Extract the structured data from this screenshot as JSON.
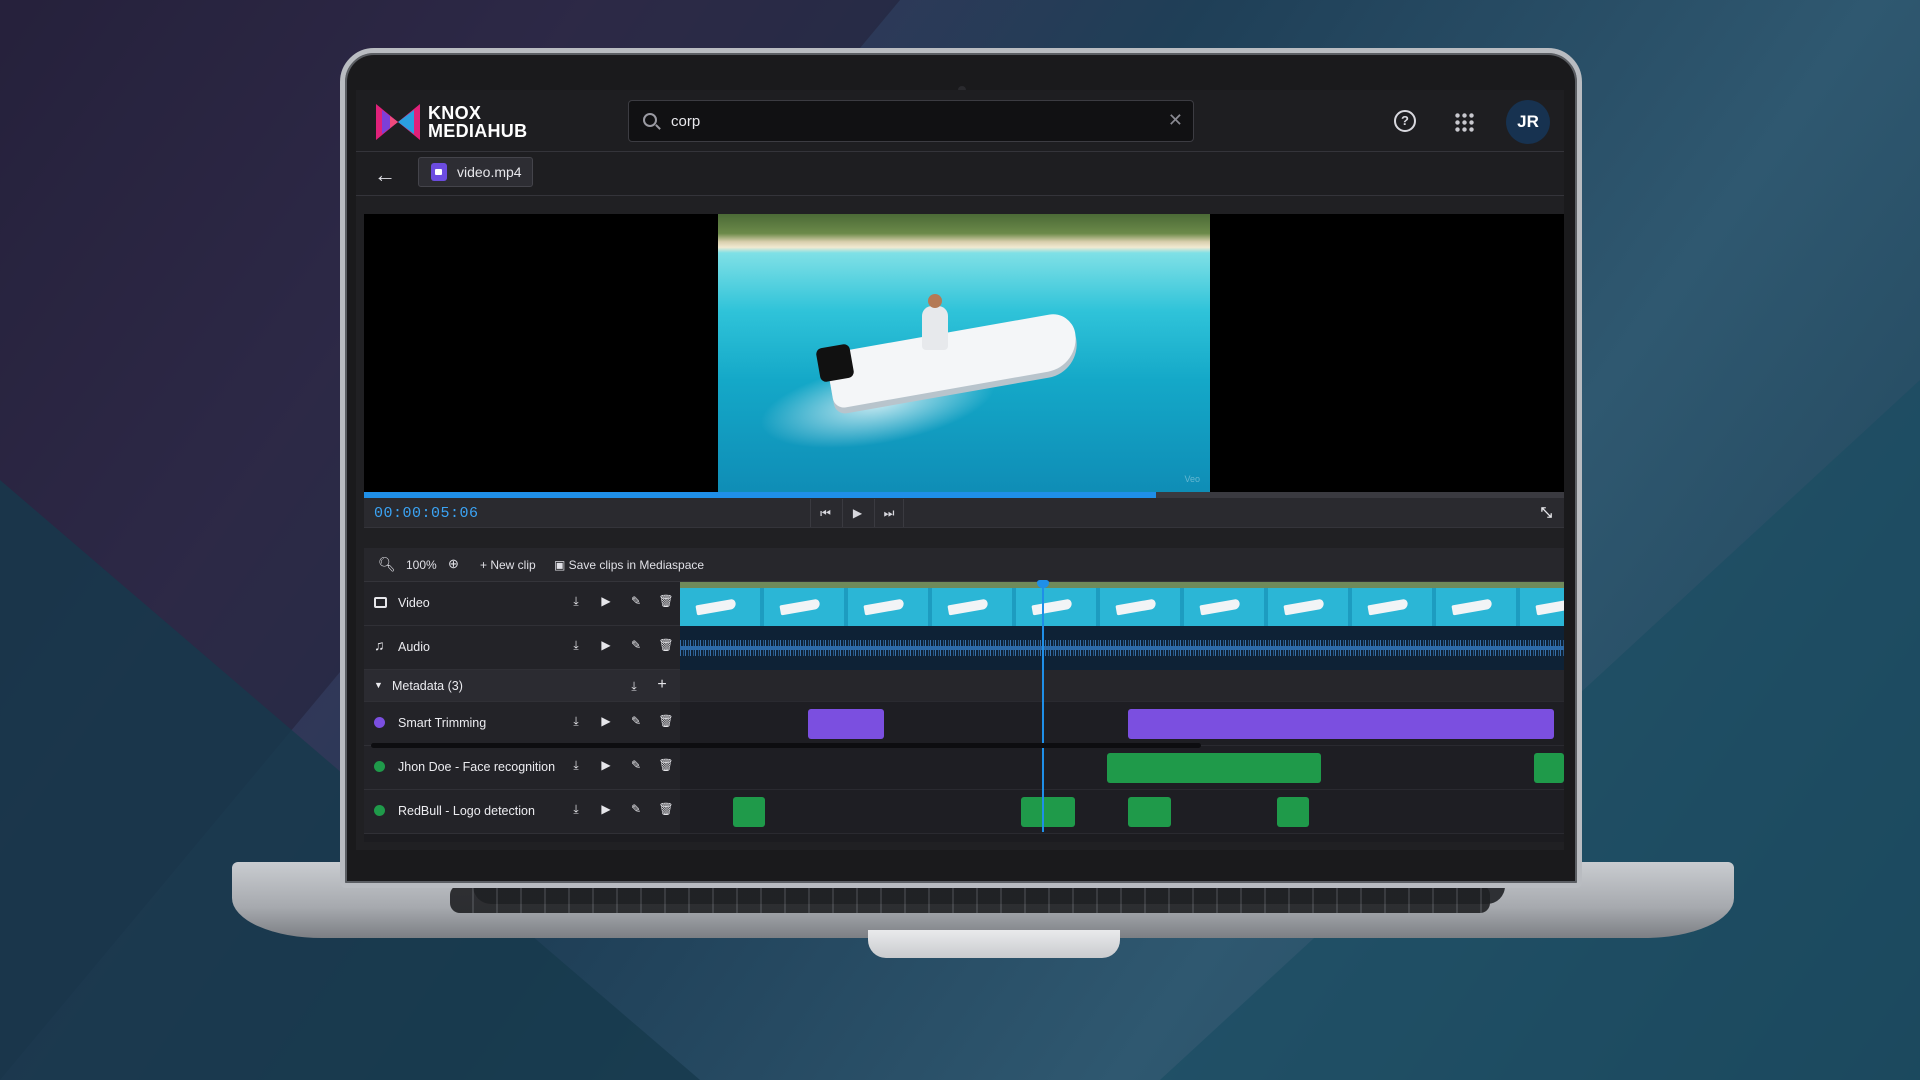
{
  "app": {
    "logo_line1": "KNOX",
    "logo_line2": "MEDIAHUB",
    "avatar_initials": "JR"
  },
  "search": {
    "value": "corp"
  },
  "file": {
    "name": "video.mp4"
  },
  "player": {
    "timecode": "00:00:05:06",
    "progress": 0.66,
    "watermark": "Veo"
  },
  "toolbar": {
    "zoom": "100%",
    "new_clip": "New clip",
    "save_clips": "Save clips in Mediaspace"
  },
  "tracks": {
    "video": "Video",
    "audio": "Audio",
    "metadata_group": "Metadata (3)",
    "smart_trimming": "Smart Trimming",
    "face_recognition": "Jhon Doe - Face recognition",
    "logo_detection": "RedBull - Logo detection"
  },
  "colors": {
    "accent": "#1f8fe8",
    "smart_trimming": "#7b4fe0",
    "detection": "#1f9a4a",
    "avatar_bg": "#173250"
  },
  "icons": {
    "video_track": "film-icon",
    "audio_track": "music-note-icon",
    "actions": [
      "download-icon",
      "play-icon",
      "edit-icon",
      "trash-icon"
    ]
  }
}
